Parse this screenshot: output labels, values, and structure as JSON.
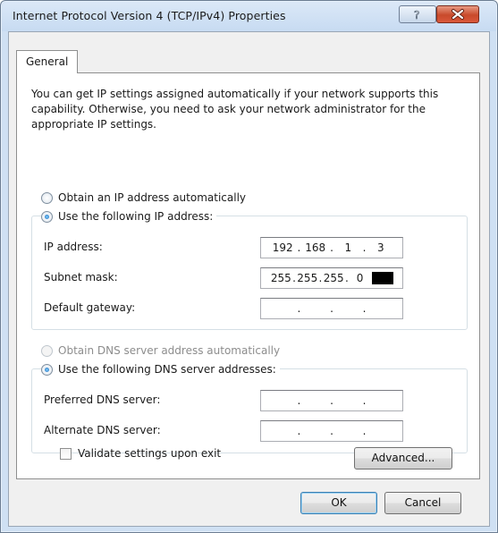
{
  "window": {
    "title": "Internet Protocol Version 4 (TCP/IPv4) Properties",
    "help_label": "?"
  },
  "tabs": [
    {
      "label": "General",
      "selected": true
    }
  ],
  "intro_text": "You can get IP settings assigned automatically if your network supports this capability. Otherwise, you need to ask your network administrator for the appropriate IP settings.",
  "ip_mode": {
    "auto_label": "Obtain an IP address automatically",
    "manual_label": "Use the following IP address:",
    "selected": "manual"
  },
  "ip_fields": {
    "ip_address": {
      "label": "IP address:",
      "octets": [
        "192",
        "168",
        "1",
        "3"
      ]
    },
    "subnet_mask": {
      "label": "Subnet mask:",
      "octets": [
        "255",
        "255",
        "255",
        "0"
      ]
    },
    "default_gateway": {
      "label": "Default gateway:",
      "octets": [
        "",
        "",
        "",
        ""
      ]
    }
  },
  "dns_mode": {
    "auto_label": "Obtain DNS server address automatically",
    "manual_label": "Use the following DNS server addresses:",
    "selected": "manual",
    "auto_enabled": false
  },
  "dns_fields": {
    "preferred": {
      "label": "Preferred DNS server:",
      "octets": [
        "",
        "",
        "",
        ""
      ]
    },
    "alternate": {
      "label": "Alternate DNS server:",
      "octets": [
        "",
        "",
        "",
        ""
      ]
    }
  },
  "validate": {
    "label": "Validate settings upon exit",
    "checked": false
  },
  "buttons": {
    "advanced": "Advanced...",
    "ok": "OK",
    "cancel": "Cancel"
  },
  "colors": {
    "titlebar": "#c7dbf2",
    "close_button": "#c84a2b",
    "panel": "#ffffff"
  }
}
